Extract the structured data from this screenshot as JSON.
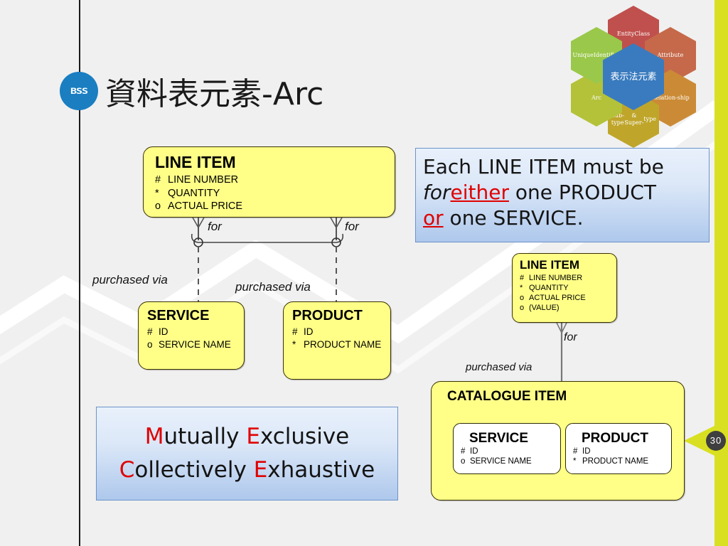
{
  "slide": {
    "title": "資料表元素-Arc",
    "logo_text": "BSS",
    "page_number": "30",
    "background_color": "#f0f0f0",
    "accent_bar_color": "#d9e021"
  },
  "hex_cluster": {
    "center": {
      "label": "表示法\n元素",
      "color": "#3a7bbf"
    },
    "items": [
      {
        "label": "Entity\nClass",
        "color": "#c0504d"
      },
      {
        "label": "Attribute",
        "color": "#c5694a"
      },
      {
        "label": "Relation-\nship",
        "color": "#cb8b36"
      },
      {
        "label": "Sub-type\n& Super-\ntype",
        "color": "#bfa62b"
      },
      {
        "label": "Arc",
        "color": "#b4c23a"
      },
      {
        "label": "Unique\nIdentifier",
        "color": "#9ac84a"
      }
    ]
  },
  "entities": {
    "line_item_left": {
      "name": "LINE ITEM",
      "attributes": [
        {
          "mark": "#",
          "label": "LINE NUMBER"
        },
        {
          "mark": "*",
          "label": "QUANTITY"
        },
        {
          "mark": "o",
          "label": "ACTUAL PRICE"
        }
      ]
    },
    "service_left": {
      "name": "SERVICE",
      "attributes": [
        {
          "mark": "#",
          "label": "ID"
        },
        {
          "mark": "o",
          "label": "SERVICE NAME"
        }
      ]
    },
    "product_left": {
      "name": "PRODUCT",
      "attributes": [
        {
          "mark": "#",
          "label": "ID"
        },
        {
          "mark": "*",
          "label": "PRODUCT NAME"
        }
      ]
    },
    "line_item_right": {
      "name": "LINE ITEM",
      "attributes": [
        {
          "mark": "#",
          "label": "LINE NUMBER"
        },
        {
          "mark": "*",
          "label": "QUANTITY"
        },
        {
          "mark": "o",
          "label": "ACTUAL PRICE"
        },
        {
          "mark": "o",
          "label": "(VALUE)"
        }
      ]
    },
    "catalogue_item": {
      "name": "CATALOGUE ITEM",
      "subtypes": {
        "service": {
          "name": "SERVICE",
          "attributes": [
            {
              "mark": "#",
              "label": "ID"
            },
            {
              "mark": "o",
              "label": "SERVICE NAME"
            }
          ]
        },
        "product": {
          "name": "PRODUCT",
          "attributes": [
            {
              "mark": "#",
              "label": "ID"
            },
            {
              "mark": "*",
              "label": "PRODUCT NAME"
            }
          ]
        }
      }
    }
  },
  "relationship_labels": {
    "for_left_1": "for",
    "for_left_2": "for",
    "purchased_via_left_1": "purchased via",
    "purchased_via_left_2": "purchased via",
    "for_right": "for",
    "purchased_via_right": "purchased via"
  },
  "callouts": {
    "rule": {
      "line1_a": "Each LINE ITEM must be",
      "line2_italic": "for",
      "line2_red": "either",
      "line2_rest": " one PRODUCT",
      "line3_red": "or",
      "line3_rest": " one SERVICE."
    },
    "mece": {
      "line1_cap": "M",
      "line1_a": "utually ",
      "line1_cap2": "E",
      "line1_b": "xclusive",
      "line2_cap": "C",
      "line2_a": "ollectively ",
      "line2_cap2": "E",
      "line2_b": "xhaustive"
    }
  }
}
